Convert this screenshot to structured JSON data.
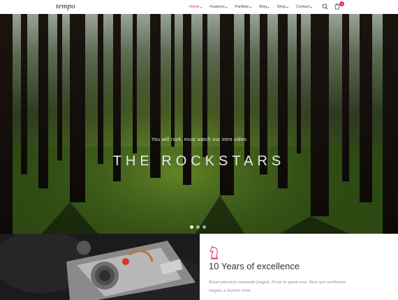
{
  "header": {
    "logo": "tempo",
    "nav": [
      {
        "label": "Home",
        "active": true
      },
      {
        "label": "Features",
        "active": false
      },
      {
        "label": "Portfolio",
        "active": false
      },
      {
        "label": "Blog",
        "active": false
      },
      {
        "label": "Shop",
        "active": false
      },
      {
        "label": "Contact",
        "active": false
      }
    ],
    "cart_count": "0",
    "accent_color": "#e3305f"
  },
  "hero": {
    "subtitle": "You will rock, must watch our intro video",
    "title": "THE ROCKSTARS",
    "slides": 3,
    "active_slide": 1
  },
  "feature": {
    "icon": "chess-knight-icon",
    "title": "10 Years of excellence",
    "text": "Etiam placerat commodo feugiat. Proin in quam erat. Duis sed vestibulum magna, a laoreet enim."
  }
}
